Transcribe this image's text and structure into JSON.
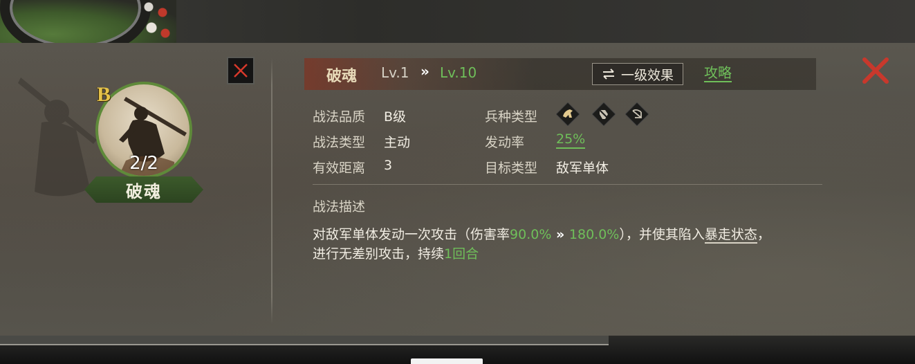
{
  "skill": {
    "name": "破魂",
    "grade_badge": "B",
    "uses": "2/2",
    "level_from": "Lv.1",
    "level_arrow": "»",
    "level_to": "Lv.10"
  },
  "header": {
    "effect_button_icon": "swap-arrows-icon",
    "effect_button_label": "一级效果",
    "strategy_link": "攻略"
  },
  "attributes": {
    "quality_label": "战法品质",
    "quality_value": "B级",
    "type_label": "战法类型",
    "type_value": "主动",
    "range_label": "有效距离",
    "range_value": "3",
    "troop_label": "兵种类型",
    "troop_icons": [
      "cavalry-icon",
      "shield-icon",
      "bow-icon"
    ],
    "rate_label": "发动率",
    "rate_value": "25%",
    "target_label": "目标类型",
    "target_value": "敌军单体"
  },
  "description": {
    "title": "战法描述",
    "line1_a": "对敌军单体发动一次攻击（伤害率",
    "damage_from": "90.0%",
    "arrow": " » ",
    "damage_to": "180.0%",
    "line1_b": "），并使其陷入",
    "status_name": "暴走状态",
    "line1_c": "，",
    "line2_a": "进行无差别攻击，持续",
    "duration": "1回合"
  },
  "colors": {
    "accent_green": "#6fbf5a",
    "grade_gold": "#e6c34a",
    "close_red": "#c8382c"
  }
}
